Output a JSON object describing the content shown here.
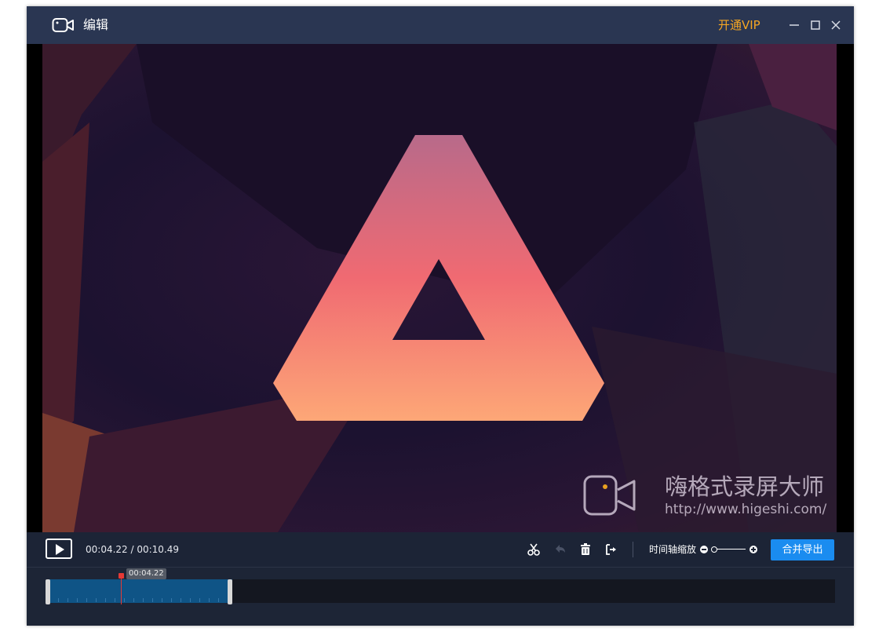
{
  "window": {
    "title": "编辑",
    "vip_label": "开通VIP",
    "accent_vip": "#f5a623"
  },
  "preview": {
    "watermark_title": "嗨格式录屏大师",
    "watermark_url": "http://www.higeshi.com/"
  },
  "controls": {
    "current_time": "00:04.22",
    "total_time": "00:10.49",
    "time_display": "00:04.22 / 00:10.49",
    "zoom_label": "时间轴缩放",
    "export_label": "合并导出",
    "accent_export": "#1a8cf0",
    "tools": [
      "scissors-icon",
      "undo-icon",
      "trash-icon",
      "export-icon"
    ]
  },
  "timeline": {
    "playhead_label": "00:04.22",
    "clip_color": "#0f5486",
    "playhead_color": "#e53935"
  }
}
